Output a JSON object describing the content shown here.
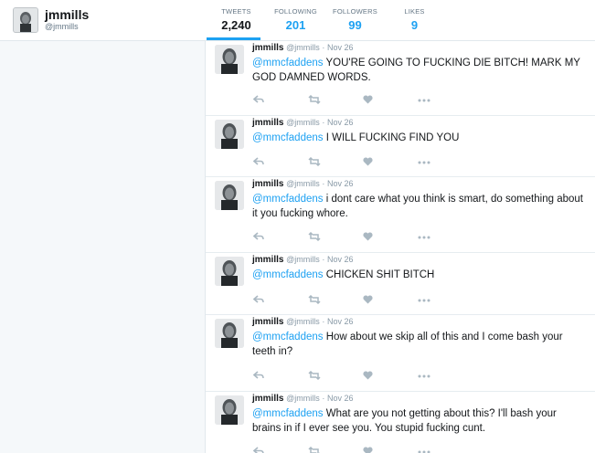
{
  "profile": {
    "name": "jmmills",
    "handle": "@jmmills"
  },
  "stats": [
    {
      "label": "TWEETS",
      "value": "2,240"
    },
    {
      "label": "FOLLOWING",
      "value": "201"
    },
    {
      "label": "FOLLOWERS",
      "value": "99"
    },
    {
      "label": "LIKES",
      "value": "9"
    }
  ],
  "tweets": [
    {
      "name": "jmmills",
      "handle": "@jmmills",
      "dot": "·",
      "time": "Nov 26",
      "mention": "@mmcfaddens",
      "text": " YOU'RE GOING TO FUCKING DIE BITCH! MARK MY GOD DAMNED WORDS."
    },
    {
      "name": "jmmills",
      "handle": "@jmmills",
      "dot": "·",
      "time": "Nov 26",
      "mention": "@mmcfaddens",
      "text": " I WILL FUCKING FIND YOU"
    },
    {
      "name": "jmmills",
      "handle": "@jmmills",
      "dot": "·",
      "time": "Nov 26",
      "mention": "@mmcfaddens",
      "text": " i dont care what you think is smart, do something about it you fucking whore."
    },
    {
      "name": "jmmills",
      "handle": "@jmmills",
      "dot": "·",
      "time": "Nov 26",
      "mention": "@mmcfaddens",
      "text": " CHICKEN SHIT BITCH"
    },
    {
      "name": "jmmills",
      "handle": "@jmmills",
      "dot": "·",
      "time": "Nov 26",
      "mention": "@mmcfaddens",
      "text": " How about we skip all of this and I come bash your teeth in?"
    },
    {
      "name": "jmmills",
      "handle": "@jmmills",
      "dot": "·",
      "time": "Nov 26",
      "mention": "@mmcfaddens",
      "text": " What are you not getting about this? I'll bash your brains in if I ever see you. You stupid fucking cunt."
    }
  ],
  "tweet_actions": [
    "reply-icon",
    "retweet-icon",
    "like-icon",
    "more-icon"
  ],
  "colors": {
    "accent": "#1da1f2",
    "muted": "#8899a6",
    "icon": "#aab8c2"
  }
}
